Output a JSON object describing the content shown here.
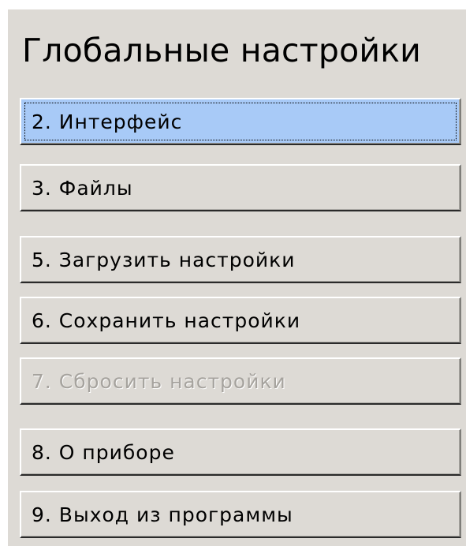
{
  "title": "Глобальные настройки",
  "menu": {
    "items": [
      {
        "label": "2. Интерфейс",
        "state": "selected"
      },
      {
        "label": "3. Файлы",
        "state": "normal"
      },
      {
        "label": "5. Загрузить настройки",
        "state": "normal"
      },
      {
        "label": "6. Сохранить настройки",
        "state": "normal"
      },
      {
        "label": "7. Сбросить настройки",
        "state": "disabled"
      },
      {
        "label": "8. О приборе",
        "state": "normal"
      },
      {
        "label": "9. Выход из программы",
        "state": "normal"
      }
    ]
  },
  "colors": {
    "background": "#dddad5",
    "selected": "#a8caf7",
    "disabled_text": "#a6a39e"
  }
}
